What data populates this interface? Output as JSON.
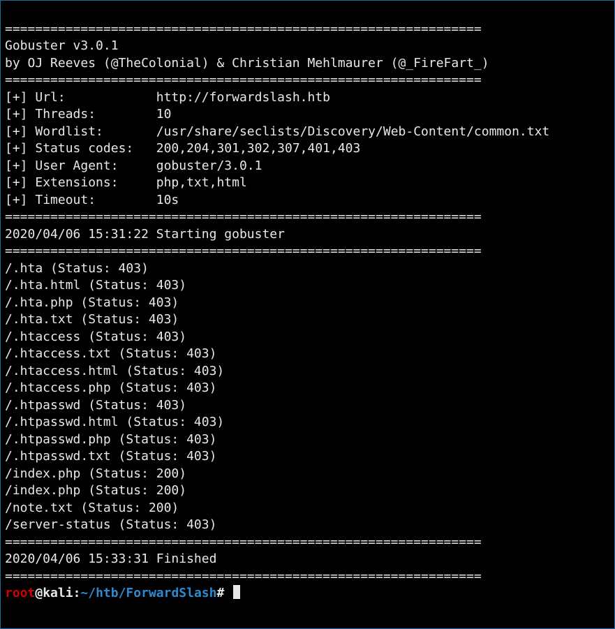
{
  "hr": "===============================================================",
  "banner": {
    "line1": "Gobuster v3.0.1",
    "line2": "by OJ Reeves (@TheColonial) & Christian Mehlmaurer (@_FireFart_)"
  },
  "config": {
    "url": {
      "label": "Url:",
      "value": "http://forwardslash.htb"
    },
    "threads": {
      "label": "Threads:",
      "value": "10"
    },
    "wordlist": {
      "label": "Wordlist:",
      "value": "/usr/share/seclists/Discovery/Web-Content/common.txt"
    },
    "status_codes": {
      "label": "Status codes:",
      "value": "200,204,301,302,307,401,403"
    },
    "user_agent": {
      "label": "User Agent:",
      "value": "gobuster/3.0.1"
    },
    "extensions": {
      "label": "Extensions:",
      "value": "php,txt,html"
    },
    "timeout": {
      "label": "Timeout:",
      "value": "10s"
    }
  },
  "start_line": "2020/04/06 15:31:22 Starting gobuster",
  "results": [
    "/.hta (Status: 403)",
    "/.hta.html (Status: 403)",
    "/.hta.php (Status: 403)",
    "/.hta.txt (Status: 403)",
    "/.htaccess (Status: 403)",
    "/.htaccess.txt (Status: 403)",
    "/.htaccess.html (Status: 403)",
    "/.htaccess.php (Status: 403)",
    "/.htpasswd (Status: 403)",
    "/.htpasswd.html (Status: 403)",
    "/.htpasswd.php (Status: 403)",
    "/.htpasswd.txt (Status: 403)",
    "/index.php (Status: 200)",
    "/index.php (Status: 200)",
    "/note.txt (Status: 200)",
    "/server-status (Status: 403)"
  ],
  "end_line": "2020/04/06 15:33:31 Finished",
  "prompt": {
    "user": "root",
    "at": "@",
    "host": "kali",
    "colon": ":",
    "path": "~/htb/ForwardSlash",
    "hash": "#"
  }
}
